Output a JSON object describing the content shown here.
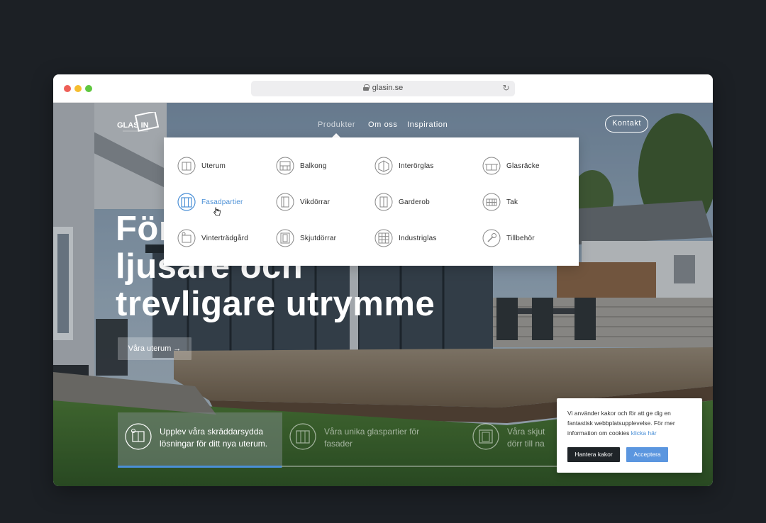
{
  "browser": {
    "url": "glasin.se"
  },
  "header": {
    "logo_text": "GLAS IN",
    "nav": [
      {
        "label": "Produkter"
      },
      {
        "label": "Om oss"
      },
      {
        "label": "Inspiration"
      }
    ],
    "contact_label": "Kontakt"
  },
  "dropdown": {
    "items": [
      {
        "label": "Uterum",
        "icon": "sunroom-icon"
      },
      {
        "label": "Balkong",
        "icon": "balcony-icon"
      },
      {
        "label": "Interörglas",
        "icon": "interior-glass-icon"
      },
      {
        "label": "Glasräcke",
        "icon": "glass-railing-icon"
      },
      {
        "label": "Fasadpartier",
        "icon": "facade-icon"
      },
      {
        "label": "Vikdörrar",
        "icon": "folding-door-icon"
      },
      {
        "label": "Garderob",
        "icon": "wardrobe-icon"
      },
      {
        "label": "Tak",
        "icon": "roof-icon"
      },
      {
        "label": "Vinterträdgård",
        "icon": "winter-garden-icon"
      },
      {
        "label": "Skjutdörrar",
        "icon": "sliding-door-icon"
      },
      {
        "label": "Industriglas",
        "icon": "industrial-glass-icon"
      },
      {
        "label": "Tillbehör",
        "icon": "wrench-icon"
      }
    ],
    "active_label": "Fasadpartier"
  },
  "hero": {
    "title_line1": "För",
    "title_line2": "ljusare och",
    "title_line3": "trevligare utrymme",
    "cta_label": "Våra uterum →"
  },
  "features": [
    {
      "text_line1": "Upplev våra skräddarsydda",
      "text_line2": "lösningar för ditt nya uterum.",
      "icon": "sunroom-icon"
    },
    {
      "text_line1": "Våra unika glaspartier för",
      "text_line2": "fasader",
      "icon": "facade-icon"
    },
    {
      "text_line1": "Våra skjut",
      "text_line2": "dörr till na",
      "icon": "sliding-door-icon"
    }
  ],
  "feature_progress": 0.35,
  "cookie": {
    "text": "Vi använder kakor och för att ge dig en fantastisk webbplatsupplevelse. För mer information om cookies",
    "link": "klicka här",
    "manage_label": "Hantera kakor",
    "accept_label": "Acceptera"
  },
  "colors": {
    "accent": "#4a8fd6",
    "dark_button": "#1f2428",
    "accept_button": "#5b96df"
  }
}
